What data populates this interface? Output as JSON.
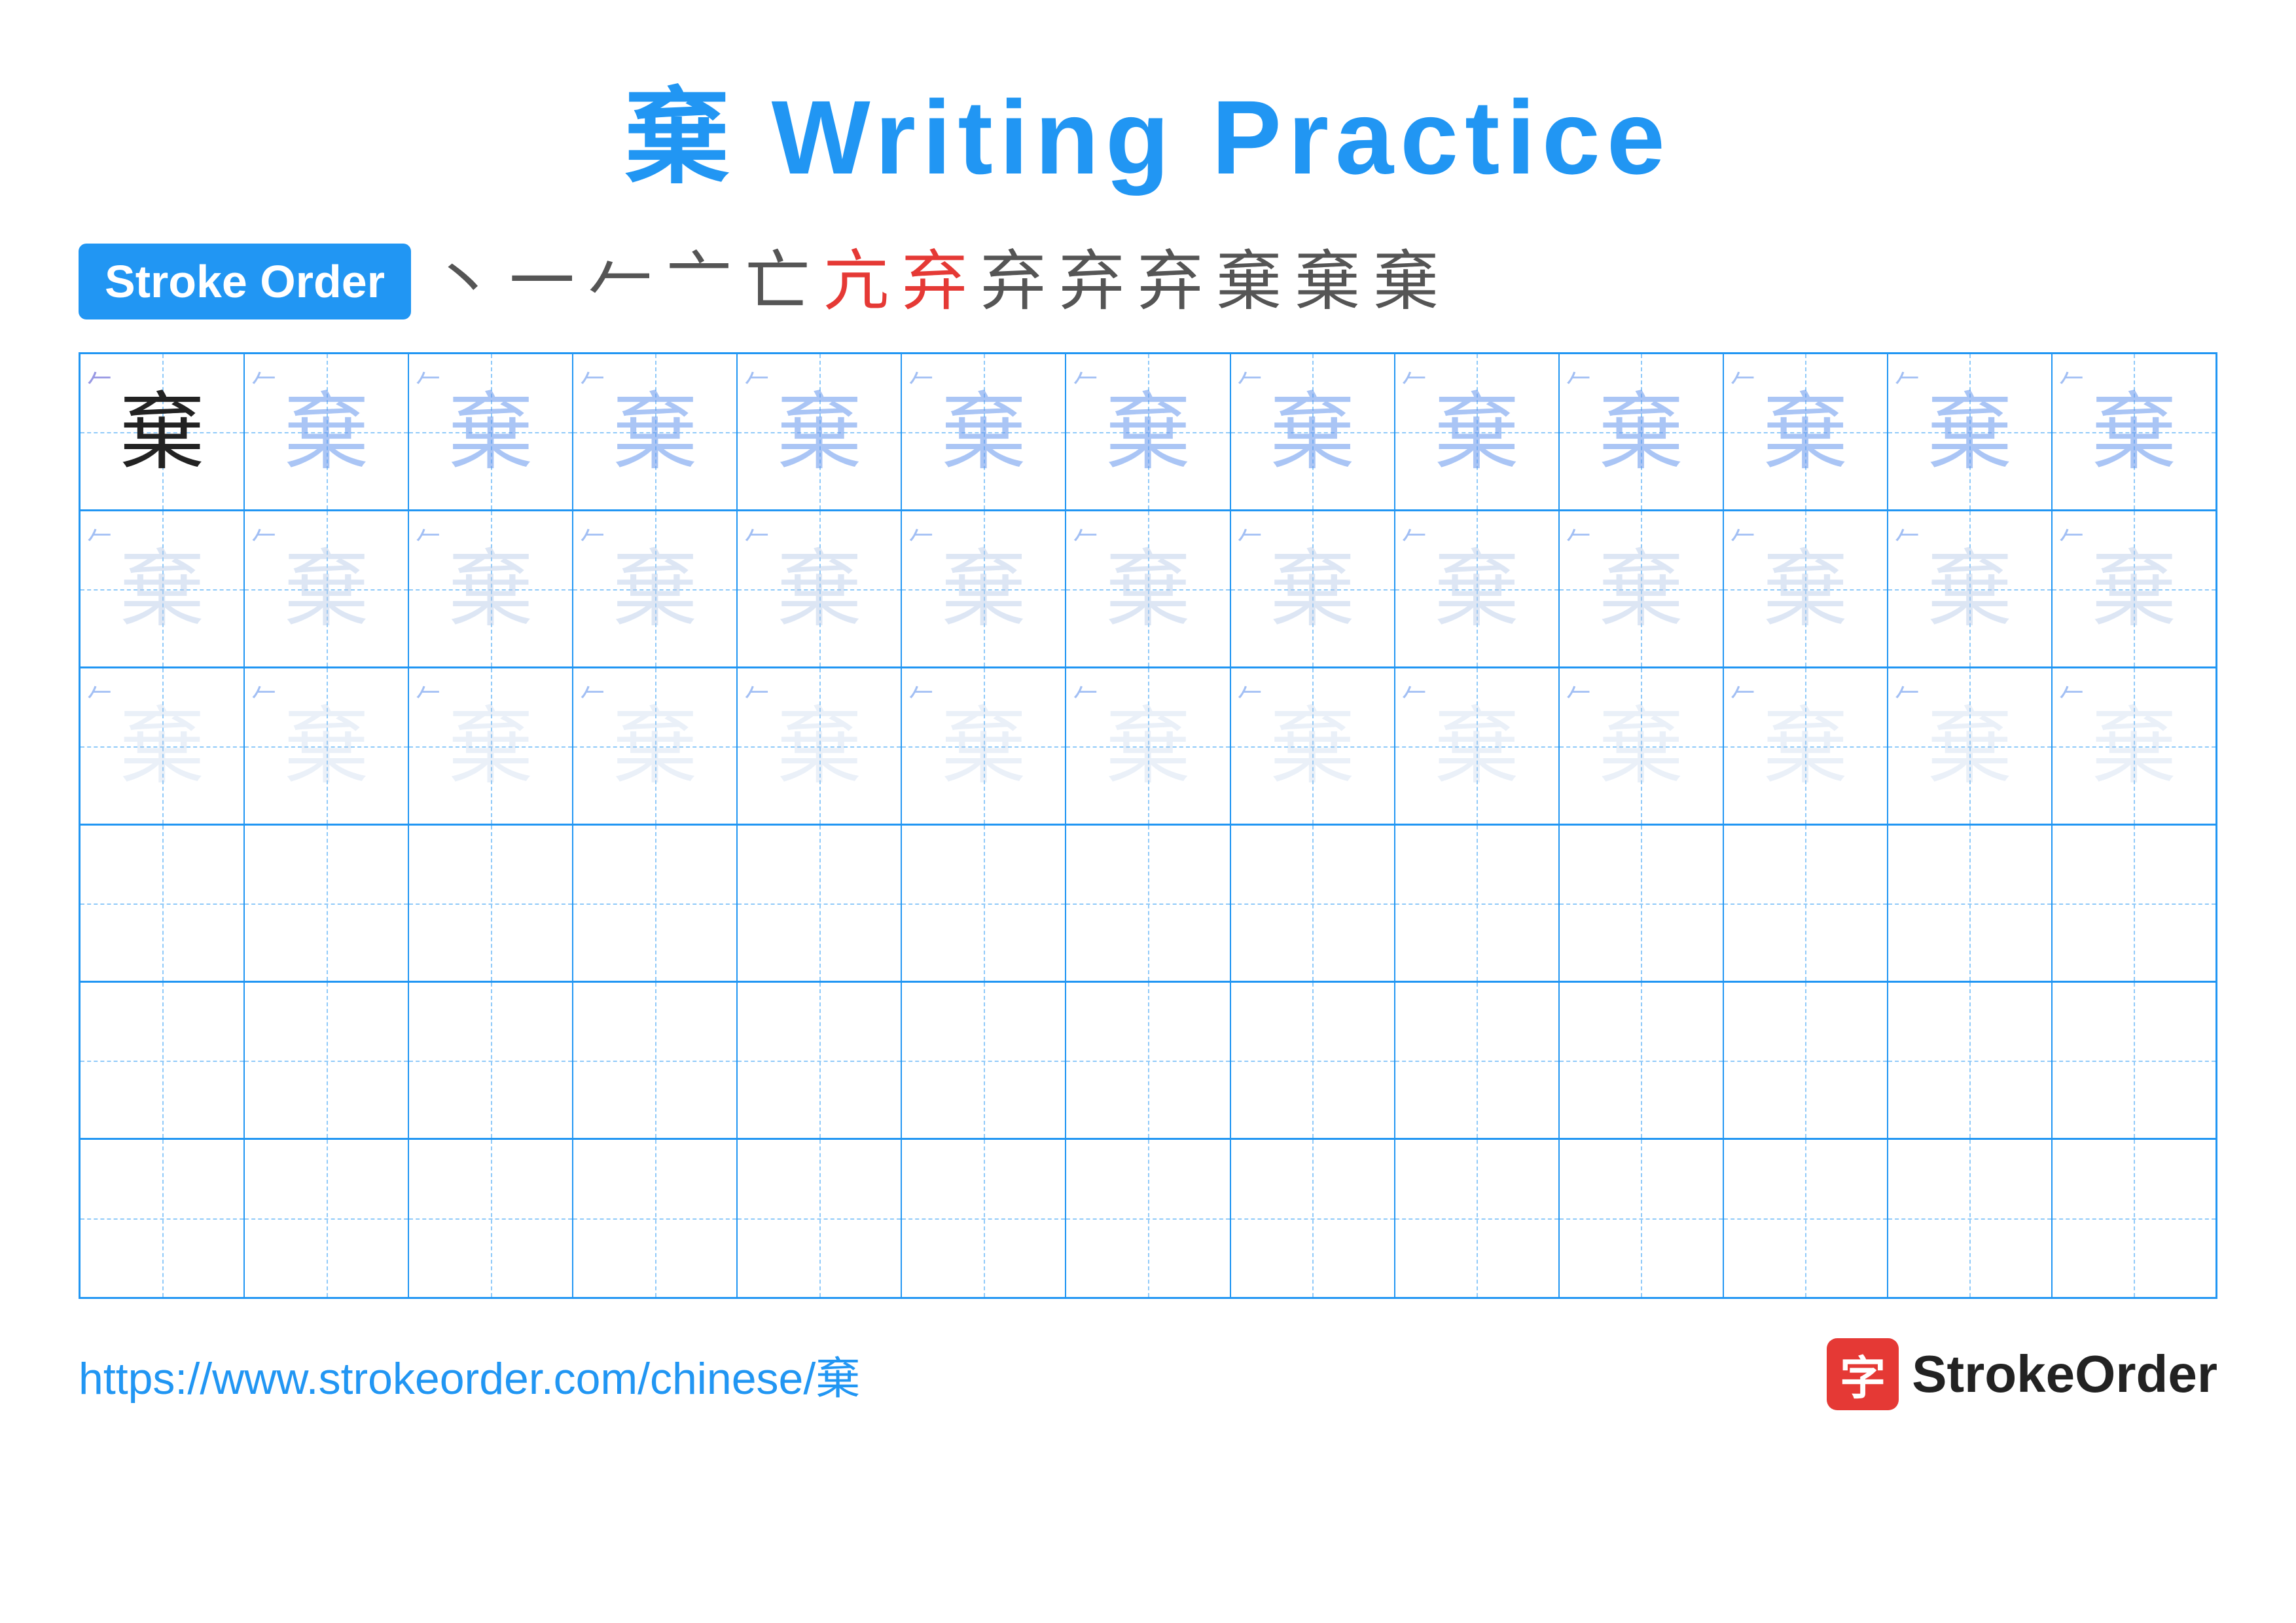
{
  "title": {
    "char": "棄",
    "text": " Writing Practice"
  },
  "stroke_order": {
    "badge_label": "Stroke Order",
    "steps": [
      "丶",
      "一",
      "𠂉",
      "亠",
      "亡",
      "亢",
      "弃",
      "弃",
      "弃",
      "弃",
      "棄",
      "棄",
      "棄"
    ]
  },
  "grid": {
    "rows": 6,
    "cols": 13
  },
  "footer": {
    "url": "https://www.strokeorder.com/chinese/棄",
    "logo_text": "StrokeOrder",
    "logo_char": "字"
  }
}
